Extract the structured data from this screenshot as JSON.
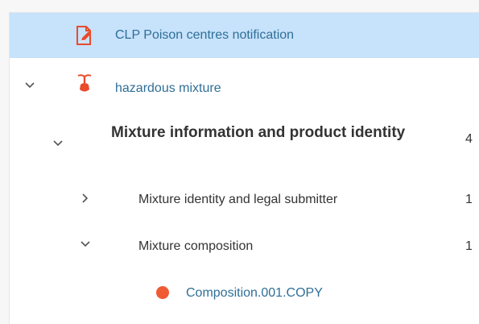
{
  "tree": {
    "root": {
      "label": "CLP Poison centres notification",
      "icon": "edit-document-icon",
      "accent": "#e94b2c",
      "selected_bg": "#c7e2fb"
    },
    "mixture": {
      "label": "hazardous mixture",
      "icon": "flask-icon",
      "expanded": true
    },
    "info": {
      "label": "Mixture information and product identity",
      "count": "4",
      "expanded": true
    },
    "identity": {
      "label": "Mixture identity and legal submitter",
      "count": "1",
      "expanded": false
    },
    "composition": {
      "label": "Mixture composition",
      "count": "1",
      "expanded": true
    },
    "comp001": {
      "label": "Composition.001.COPY",
      "status_color": "#f05a33",
      "icon": "status-dot-icon"
    }
  }
}
